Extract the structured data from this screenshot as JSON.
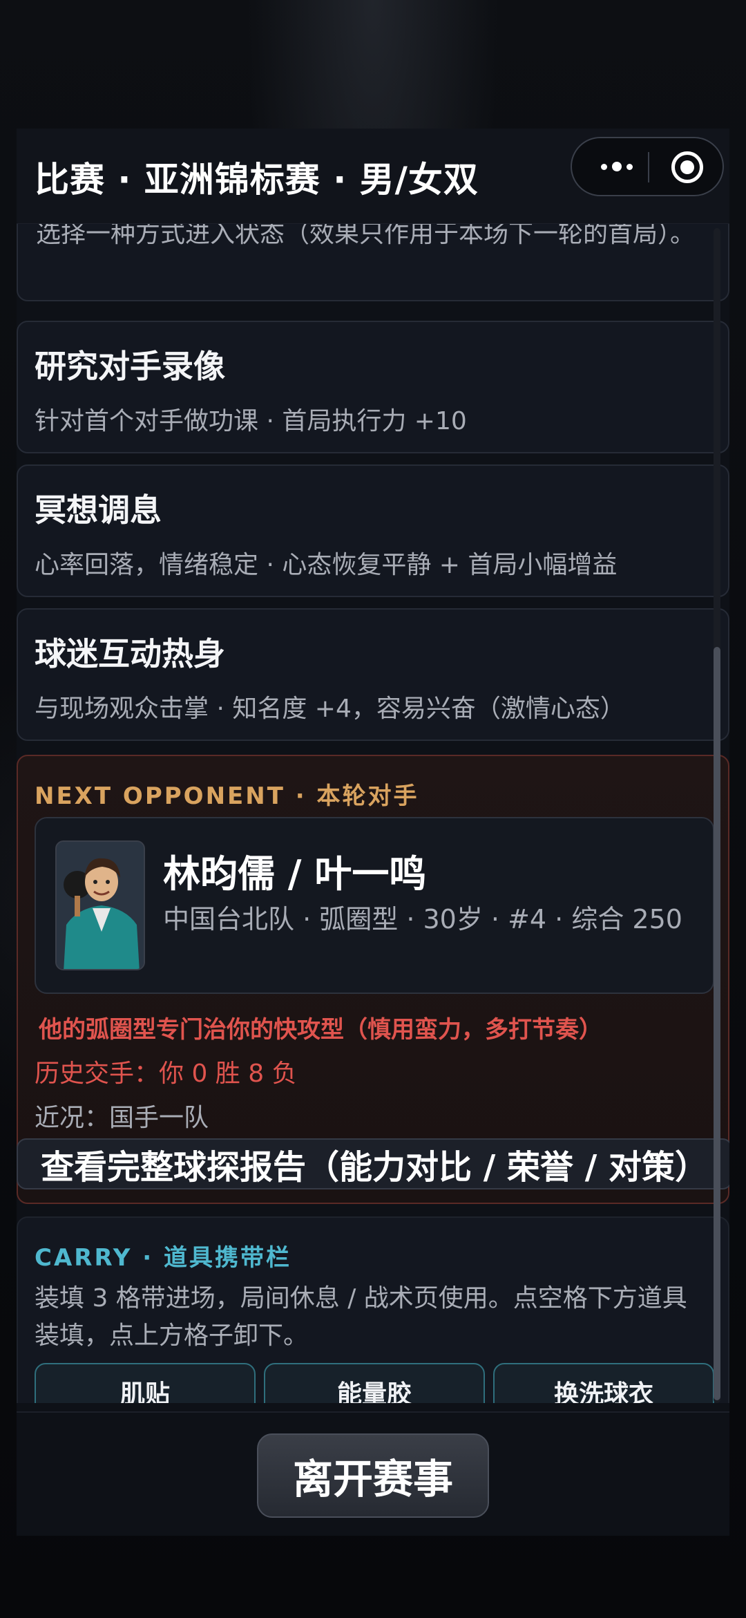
{
  "header": {
    "title": "比赛 · 亚洲锦标赛 · 男/女双"
  },
  "intro": {
    "text": "选择一种方式进入状态（效果只作用于本场下一轮的首局）。"
  },
  "options": [
    {
      "title": "研究对手录像",
      "desc": "针对首个对手做功课 · 首局执行力 +10"
    },
    {
      "title": "冥想调息",
      "desc": "心率回落，情绪稳定 · 心态恢复平静 + 首局小幅增益"
    },
    {
      "title": "球迷互动热身",
      "desc": "与现场观众击掌 · 知名度 +4，容易兴奋（激情心态）"
    }
  ],
  "opponent": {
    "heading": "NEXT OPPONENT · 本轮对手",
    "name": "林昀儒 / 叶一鸣",
    "meta": "中国台北队 · 弧圈型 · 30岁 · #4 · 综合 250",
    "warning": "他的弧圈型专门治你的快攻型（慎用蛮力，多打节奏）",
    "record": "历史交手：你 0 胜 8 负",
    "recent": "近况：国手一队",
    "scout_button": "查看完整球探报告（能力对比 / 荣誉 / 对策）"
  },
  "carry": {
    "heading": "CARRY · 道具携带栏",
    "desc": "装填 3 格带进场，局间休息 / 战术页使用。点空格下方道具装填，点上方格子卸下。",
    "slots": [
      "肌贴",
      "能量胶",
      "换洗球衣"
    ]
  },
  "footer": {
    "leave_button": "离开赛事"
  },
  "colors": {
    "accent_gold": "#d9a35f",
    "accent_cyan": "#4fb8cf",
    "warning_red": "#e0544e"
  }
}
